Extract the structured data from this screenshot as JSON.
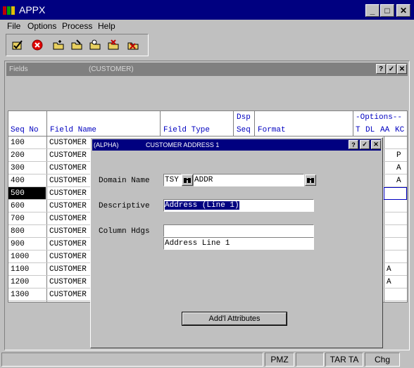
{
  "app": {
    "title": "APPX",
    "minimize": "_",
    "maximize": "□",
    "close": "✕"
  },
  "menu": [
    "File",
    "Options",
    "Process",
    "Help"
  ],
  "toolbar": {
    "icons": [
      "check-icon",
      "cancel-icon",
      "add-folder-icon",
      "edit-folder-icon",
      "search-folder-icon",
      "delete-folder-icon",
      "edit-check-icon"
    ]
  },
  "fields_window": {
    "title": "Fields",
    "subtitle": "(CUSTOMER)",
    "help": "?",
    "ok": "✓",
    "close": "✕"
  },
  "table": {
    "headers": {
      "seq_no": "Seq No",
      "field_name": "Field Name",
      "field_type": "Field Type",
      "dsp_top": "Dsp",
      "dsp_bottom": "Seq",
      "format": "Format",
      "options": "-Options--",
      "t": "T",
      "dl": "DL",
      "aa": "AA",
      "kc": "KC"
    },
    "rows": [
      {
        "seq": "100",
        "name": "CUSTOMER",
        "aa": "",
        "kc": ""
      },
      {
        "seq": "200",
        "name": "CUSTOMER",
        "aa": "",
        "kc": "P"
      },
      {
        "seq": "300",
        "name": "CUSTOMER",
        "aa": "",
        "kc": "A"
      },
      {
        "seq": "400",
        "name": "CUSTOMER",
        "aa": "",
        "kc": "A"
      },
      {
        "seq": "500",
        "name": "CUSTOMER",
        "aa": "",
        "kc": ""
      },
      {
        "seq": "600",
        "name": "CUSTOMER",
        "aa": "",
        "kc": ""
      },
      {
        "seq": "700",
        "name": "CUSTOMER",
        "aa": "",
        "kc": ""
      },
      {
        "seq": "800",
        "name": "CUSTOMER",
        "aa": "",
        "kc": ""
      },
      {
        "seq": "900",
        "name": "CUSTOMER",
        "aa": "",
        "kc": ""
      },
      {
        "seq": "1000",
        "name": "CUSTOMER",
        "aa": "",
        "kc": ""
      },
      {
        "seq": "1100",
        "name": "CUSTOMER",
        "aa": "A",
        "kc": ""
      },
      {
        "seq": "1200",
        "name": "CUSTOMER",
        "aa": "A",
        "kc": ""
      },
      {
        "seq": "1300",
        "name": "CUSTOMER",
        "aa": "",
        "kc": ""
      }
    ],
    "selected_index": 4
  },
  "dialog": {
    "title_left": "(ALPHA)",
    "title_main": "CUSTOMER ADDRESS 1",
    "help": "?",
    "ok": "✓",
    "close": "✕",
    "domain_label": "Domain Name",
    "domain_app": "TSY",
    "domain_name": "ADDR",
    "descriptive_label": "Descriptive",
    "descriptive_value": "Address (Line 1)",
    "column_hdgs_label": "Column Hdgs",
    "column_hdg_1": "",
    "column_hdg_2": "Address Line 1",
    "addl_button": "Add'l Attributes"
  },
  "statusbar": {
    "panels": [
      "",
      "",
      "",
      "PMZ",
      "",
      "TAR TA",
      "Chg"
    ]
  },
  "colors": {
    "title_active": "#000080",
    "title_inactive": "#808080",
    "header_text": "#0000c0",
    "face": "#c0c0c0"
  }
}
